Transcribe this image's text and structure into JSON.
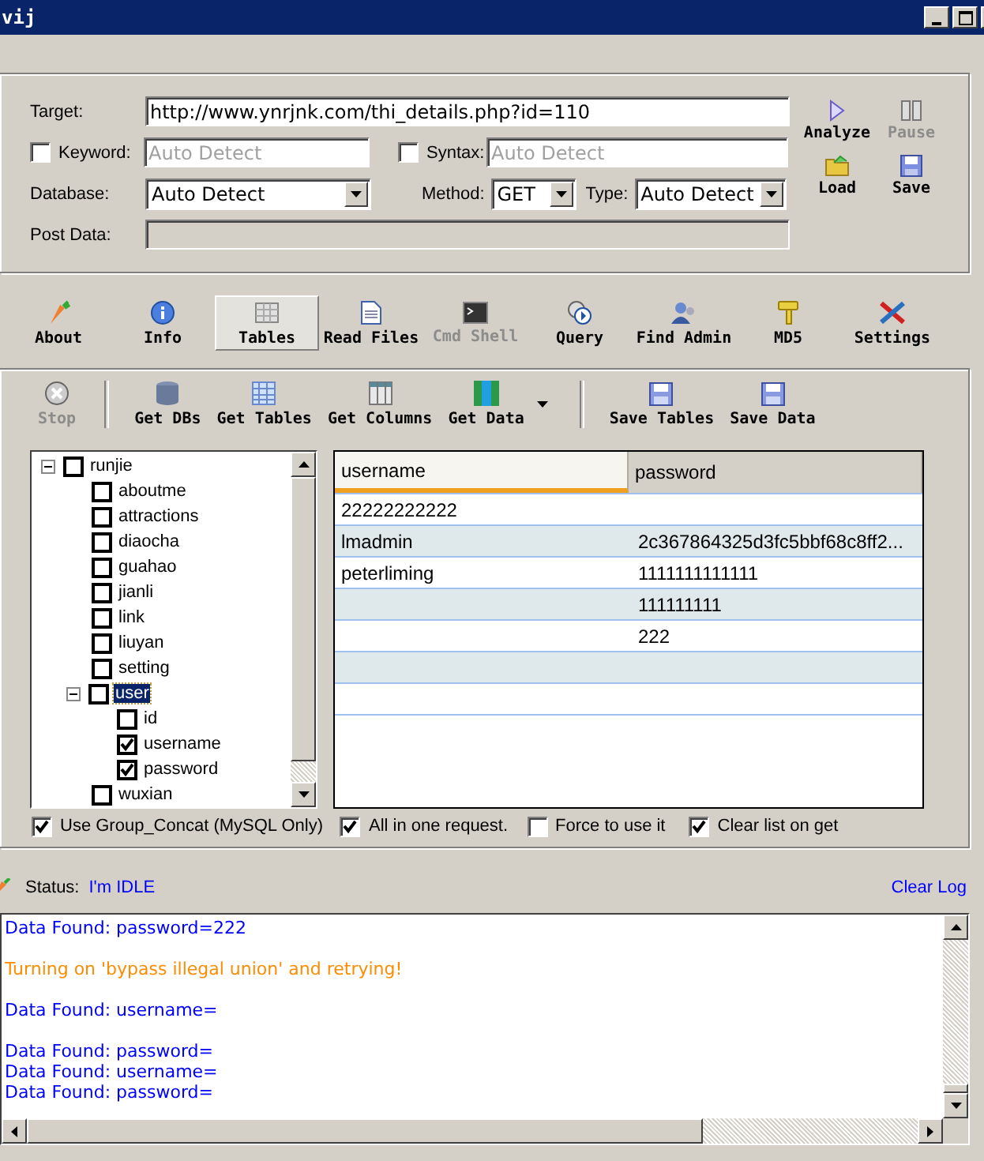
{
  "window": {
    "title": "vij"
  },
  "form": {
    "target": {
      "label": "Target:",
      "value": "http://www.ynrjnk.com/thi_details.php?id=110"
    },
    "keyword": {
      "label": "Keyword:",
      "checked": false,
      "placeholder": "Auto Detect"
    },
    "syntax": {
      "label": "Syntax:",
      "checked": false,
      "placeholder": "Auto Detect"
    },
    "database": {
      "label": "Database:",
      "value": "Auto Detect"
    },
    "method": {
      "label": "Method:",
      "value": "GET"
    },
    "type": {
      "label": "Type:",
      "value": "Auto Detect"
    },
    "post_data": {
      "label": "Post Data:",
      "disabled": true
    }
  },
  "actions": [
    {
      "label": "Analyze",
      "disabled": false
    },
    {
      "label": "Pause",
      "disabled": true
    },
    {
      "label": "Load",
      "disabled": false
    },
    {
      "label": "Save",
      "disabled": false
    }
  ],
  "toolbar": [
    {
      "label": "About",
      "selected": false,
      "disabled": false
    },
    {
      "label": "Info",
      "selected": false,
      "disabled": false
    },
    {
      "label": "Tables",
      "selected": true,
      "disabled": false
    },
    {
      "label": "Read Files",
      "selected": false,
      "disabled": false
    },
    {
      "label": "Cmd Shell",
      "selected": false,
      "disabled": true
    },
    {
      "label": "Query",
      "selected": false,
      "disabled": false
    },
    {
      "label": "Find Admin",
      "selected": false,
      "disabled": false
    },
    {
      "label": "MD5",
      "selected": false,
      "disabled": false
    },
    {
      "label": "Settings",
      "selected": false,
      "disabled": false
    }
  ],
  "subtoolbar": [
    {
      "label": "Stop",
      "disabled": true
    },
    {
      "label": "Get DBs",
      "disabled": false
    },
    {
      "label": "Get Tables",
      "disabled": false
    },
    {
      "label": "Get Columns",
      "disabled": false
    },
    {
      "label": "Get Data",
      "disabled": false,
      "dropdown": true
    },
    {
      "label": "Save Tables",
      "disabled": false
    },
    {
      "label": "Save Data",
      "disabled": false
    }
  ],
  "tree": [
    {
      "label": "runjie",
      "checked": false,
      "expanded": true,
      "selected": false,
      "children": [
        {
          "label": "aboutme",
          "checked": false,
          "selected": false
        },
        {
          "label": "attractions",
          "checked": false,
          "selected": false
        },
        {
          "label": "diaocha",
          "checked": false,
          "selected": false
        },
        {
          "label": "guahao",
          "checked": false,
          "selected": false
        },
        {
          "label": "jianli",
          "checked": false,
          "selected": false
        },
        {
          "label": "link",
          "checked": false,
          "selected": false
        },
        {
          "label": "liuyan",
          "checked": false,
          "selected": false
        },
        {
          "label": "setting",
          "checked": false,
          "selected": false
        },
        {
          "label": "user",
          "checked": false,
          "expanded": true,
          "selected": true,
          "children": [
            {
              "label": "id",
              "checked": false,
              "selected": false
            },
            {
              "label": "username",
              "checked": true,
              "selected": false
            },
            {
              "label": "password",
              "checked": true,
              "selected": false
            }
          ]
        },
        {
          "label": "wuxian",
          "checked": false,
          "selected": false
        }
      ]
    }
  ],
  "table": {
    "columns": [
      {
        "label": "username",
        "selected": true
      },
      {
        "label": "password",
        "selected": false
      }
    ],
    "rows": [
      {
        "cells": [
          "22222222222",
          null
        ]
      },
      {
        "cells": [
          "lmadmin",
          "2c367864325d3fc5bbf68c8ff2..."
        ]
      },
      {
        "cells": [
          "peterliming",
          "1111111111111"
        ]
      },
      {
        "cells": [
          null,
          "111111111"
        ]
      },
      {
        "cells": [
          null,
          "222"
        ]
      },
      {
        "cells": [
          null,
          null
        ]
      },
      {
        "cells": [
          null,
          null
        ]
      }
    ]
  },
  "options": [
    {
      "label": "Use Group_Concat (MySQL Only)",
      "checked": true
    },
    {
      "label": "All in one request.",
      "checked": true
    },
    {
      "label": "Force to use it",
      "checked": false
    },
    {
      "label": "Clear list on get",
      "checked": true
    }
  ],
  "status": {
    "label": "Status:",
    "value": "I'm IDLE",
    "clear_log": "Clear Log"
  },
  "log": [
    {
      "text": "Data Found: password=222",
      "kind": "info",
      "blank_after": true
    },
    {
      "text": "Turning on 'bypass illegal union' and retrying!",
      "kind": "warning",
      "blank_after": true
    },
    {
      "text": "Data Found: username=",
      "kind": "info",
      "blank_after": true
    },
    {
      "text": "Data Found: password=",
      "kind": "info",
      "blank_after": false
    },
    {
      "text": "Data Found: username=",
      "kind": "info",
      "blank_after": false
    },
    {
      "text": "Data Found: password=",
      "kind": "info",
      "blank_after": false
    }
  ]
}
